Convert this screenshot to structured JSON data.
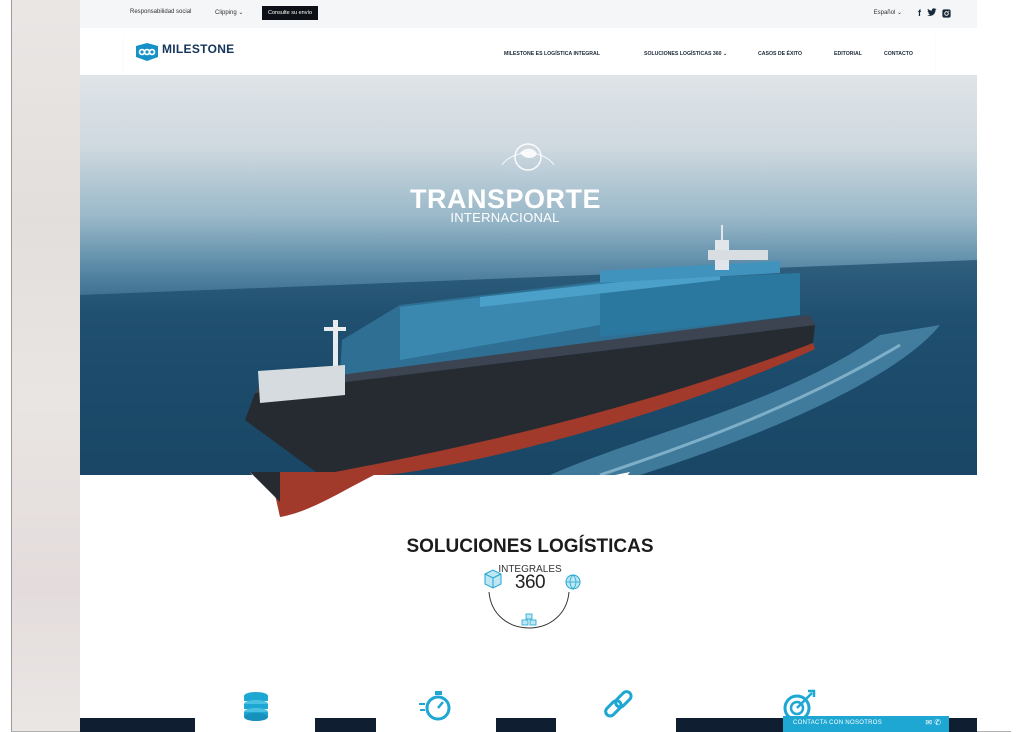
{
  "utility_bar": {
    "links": [
      "Responsabilidad social",
      "Clipping"
    ],
    "clipping_caret": "⌄",
    "button": "Consulte su envío",
    "language": "Español",
    "social_icons": [
      "facebook-icon",
      "twitter-icon",
      "instagram-icon"
    ]
  },
  "header": {
    "logo_text": "MILESTONE",
    "nav": [
      "MILESTONE ES LOGÍSTICA INTEGRAL",
      "SOLUCIONES LOGÍSTICAS 360",
      "CASOS DE ÉXITO",
      "EDITORIAL",
      "CONTACTO"
    ]
  },
  "hero": {
    "title": "TRANSPORTE",
    "subtitle": "INTERNACIONAL"
  },
  "section": {
    "title": "SOLUCIONES LOGÍSTICAS",
    "subtitle": "INTEGRALES",
    "badge": "360"
  },
  "contact": {
    "label": "CONTACTA CON NOSOTROS"
  },
  "colors": {
    "accent": "#1da7d2",
    "navy": "#14345a"
  }
}
